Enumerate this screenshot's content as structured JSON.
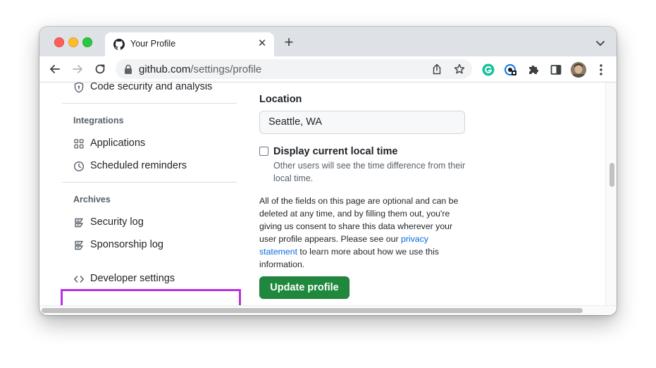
{
  "browser": {
    "tab_title": "Your Profile",
    "new_tab_icon": "+",
    "url_host": "github.com",
    "url_path": "/settings/profile"
  },
  "sidebar": {
    "items_top": [
      {
        "label": "Code security and analysis",
        "icon": "shield-icon"
      }
    ],
    "integrations_heading": "Integrations",
    "integrations": [
      {
        "label": "Applications",
        "icon": "apps-grid-icon"
      },
      {
        "label": "Scheduled reminders",
        "icon": "clock-icon"
      }
    ],
    "archives_heading": "Archives",
    "archives": [
      {
        "label": "Security log",
        "icon": "log-icon"
      },
      {
        "label": "Sponsorship log",
        "icon": "log-icon"
      }
    ],
    "developer_settings": {
      "label": "Developer settings",
      "icon": "code-icon"
    }
  },
  "profile_form": {
    "location_label": "Location",
    "location_value": "Seattle, WA",
    "local_time_label": "Display current local time",
    "local_time_checked": false,
    "local_time_hint": "Other users will see the time difference from their local time.",
    "note_before_link": "All of the fields on this page are optional and can be deleted at any time, and by filling them out, you're giving us consent to share this data wherever your user profile appears. Please see our",
    "note_link": "privacy statement",
    "note_after_link": "to learn more about how we use this information.",
    "update_button": "Update profile"
  },
  "colors": {
    "highlight_border": "#b833e0",
    "primary_button": "#1f883d",
    "link": "#0969da"
  }
}
